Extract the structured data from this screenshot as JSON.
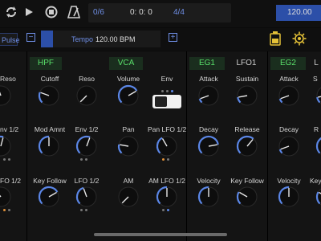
{
  "transport": {
    "step": "0/6",
    "time": "0: 0: 0",
    "signature": "4/4",
    "tempo_value": "120.00"
  },
  "toolbar": {
    "preset_label": "Pulse",
    "minus": "−",
    "plus": "+"
  },
  "tempo_slider": {
    "label": "Tempo",
    "value": "120.00 BPM",
    "level": 0.1
  },
  "columns": {
    "left_partial": {
      "labels": [
        "Reso",
        "nv 1/2",
        "FO 1/2"
      ]
    },
    "hpf": {
      "header": "HPF",
      "labels": [
        "Cutoff",
        "Reso",
        "Mod Amnt",
        "Env 1/2",
        "Key Follow",
        "LFO 1/2"
      ]
    },
    "vca": {
      "header": "VCA",
      "labels": [
        "Volume",
        "Env",
        "Pan",
        "Pan LFO 1/2",
        "AM",
        "AM LFO 1/2"
      ]
    },
    "eg1": {
      "header": "EG1",
      "labels": [
        "Attack",
        "Sustain",
        "Decay",
        "Release",
        "Velocity",
        "Key Follow"
      ]
    },
    "lfo1": {
      "header": "LFO1"
    },
    "eg2": {
      "header": "EG2",
      "labels": [
        "Attack",
        "S",
        "Decay",
        "R",
        "Velocity",
        "Key"
      ]
    },
    "right_partial_header": "L"
  },
  "colors": {
    "accent_blue": "#2c4fa8",
    "accent_green": "#5ae06a",
    "knob_arc": "#5b86e6",
    "dot_orange": "#e0913a"
  }
}
